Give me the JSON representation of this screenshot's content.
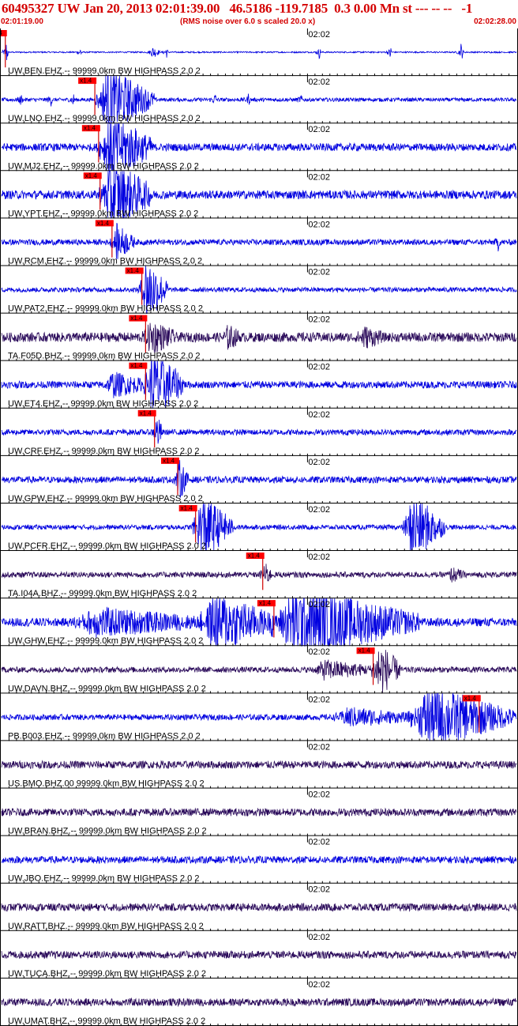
{
  "header": {
    "title": "60495327 UW Jan 20, 2013 02:01:39.00   46.5186 -119.7185  0.3 0.00 Mn st --- -- --   -1",
    "start_time": "02:01:19.00",
    "scale_note": "(RMS noise over 6.0 s scaled 20.0 x)",
    "end_time": "02:02:28.00"
  },
  "colors": {
    "header_text": "#d40000",
    "trace_blue": "#0000e0",
    "trace_purple": "#2a0a5a",
    "pick_box": "#ff0000",
    "pick_line": "#d00000",
    "grid": "#000000"
  },
  "chart_data": {
    "type": "line",
    "x_axis": {
      "start": "02:01:19.00",
      "end": "02:02:28.00",
      "duration_s": 69,
      "minute_mark_label": "02:02",
      "minute_mark_s": 41,
      "tick_interval_s": 1
    },
    "pick_label": "x1.4",
    "series": [
      {
        "name": "UW.BEN.EHZ.--",
        "label": "UW.BEN.EHZ.-- 99999.0km BW  HIGHPASS  2.0  2",
        "color": "blue",
        "pick_s": 0.5,
        "noise": 0.03,
        "bursts": [
          [
            0.6,
            0.3,
            0.6
          ],
          [
            10.5,
            0.3,
            0.3
          ],
          [
            20.0,
            1.2,
            0.25
          ],
          [
            22.0,
            0.3,
            0.3
          ],
          [
            42.5,
            0.3,
            0.3
          ],
          [
            52.0,
            0.3,
            0.35
          ],
          [
            61.5,
            0.4,
            0.4
          ]
        ]
      },
      {
        "name": "UW.LNO.EHZ.--",
        "label": "UW.LNO.EHZ.-- 99999.0km BW  HIGHPASS  2.0  2",
        "color": "blue",
        "pick_s": 12.5,
        "noise": 0.08,
        "bursts": [
          [
            2.5,
            0.3,
            0.25
          ],
          [
            6.5,
            0.3,
            0.3
          ],
          [
            9.5,
            0.3,
            0.3
          ],
          [
            13.0,
            7.5,
            1.4
          ],
          [
            28.5,
            0.3,
            0.35
          ],
          [
            33.0,
            0.3,
            0.25
          ],
          [
            40.0,
            0.3,
            0.2
          ]
        ]
      },
      {
        "name": "UW.MJ2.EHZ.--",
        "label": "UW.MJ2.EHZ.-- 99999.0km BW  HIGHPASS  2.0  2",
        "color": "blue",
        "pick_s": 13.0,
        "noise": 0.16,
        "bursts": [
          [
            13.3,
            7.0,
            1.4
          ]
        ]
      },
      {
        "name": "UW.YPT.EHZ.--",
        "label": "UW.YPT.EHZ.-- 99999.0km BW  HIGHPASS  2.0  2",
        "color": "blue",
        "pick_s": 13.2,
        "noise": 0.18,
        "bursts": [
          [
            13.4,
            7.0,
            1.4
          ]
        ]
      },
      {
        "name": "UW.RCM.EHZ.--",
        "label": "UW.RCM.EHZ.-- 99999.0km BW  HIGHPASS  2.0  2",
        "color": "blue",
        "pick_s": 14.8,
        "noise": 0.12,
        "bursts": [
          [
            15.0,
            2.8,
            0.7
          ],
          [
            66.5,
            0.3,
            0.3
          ]
        ]
      },
      {
        "name": "UW.PAT2.EHZ.--",
        "label": "UW.PAT2.EHZ.-- 99999.0km BW  HIGHPASS  2.0  2",
        "color": "blue",
        "pick_s": 18.8,
        "noise": 0.1,
        "bursts": [
          [
            18.8,
            3.5,
            1.4
          ]
        ]
      },
      {
        "name": "TA.F05D.BHZ.--",
        "label": "TA.F05D.BHZ.-- 99999.0km BW  HIGHPASS  2.0  2",
        "color": "purple",
        "pick_s": 19.3,
        "noise": 0.2,
        "bursts": [
          [
            19.3,
            4.0,
            0.6
          ],
          [
            30.0,
            2.0,
            0.4
          ],
          [
            48.0,
            3.0,
            0.35
          ]
        ]
      },
      {
        "name": "UW.ET4.EHZ.--",
        "label": "UW.ET4.EHZ.-- 99999.0km BW  HIGHPASS  2.0  2",
        "color": "blue",
        "pick_s": 19.3,
        "noise": 0.15,
        "bursts": [
          [
            14.0,
            5.5,
            0.45
          ],
          [
            19.5,
            5.0,
            1.4
          ]
        ]
      },
      {
        "name": "UW.CRF.EHZ.--",
        "label": "UW.CRF.EHZ.-- 99999.0km BW  HIGHPASS  2.0  2",
        "color": "blue",
        "pick_s": 20.5,
        "noise": 0.12,
        "bursts": [
          [
            20.6,
            1.0,
            0.7
          ]
        ]
      },
      {
        "name": "UW.GPW.EHZ.--",
        "label": "UW.GPW.EHZ.-- 99999.0km BW  HIGHPASS  2.0  2",
        "color": "blue",
        "pick_s": 23.6,
        "noise": 0.14,
        "bursts": [
          [
            23.5,
            1.5,
            0.8
          ]
        ]
      },
      {
        "name": "UW.PCFR.EHZ.--",
        "label": "UW.PCFR.EHZ.-- 99999.0km BW  HIGHPASS  2.0  2",
        "color": "blue",
        "pick_s": 26.0,
        "noise": 0.1,
        "bursts": [
          [
            26.0,
            5.0,
            1.4
          ],
          [
            54.2,
            5.2,
            1.4
          ]
        ]
      },
      {
        "name": "TA.I04A.BHZ.--",
        "label": "TA.I04A.BHZ.-- 99999.0km BW  HIGHPASS  2.0  2",
        "color": "purple",
        "pick_s": 35.0,
        "noise": 0.12,
        "bursts": [
          [
            35.0,
            1.2,
            0.45
          ],
          [
            60.0,
            2.0,
            0.25
          ]
        ]
      },
      {
        "name": "UW.GHW.EHZ.--",
        "label": "UW.GHW.EHZ.-- 99999.0km BW  HIGHPASS  2.0  2",
        "color": "blue",
        "pick_s": 36.5,
        "noise": 0.18,
        "bursts": [
          [
            10.0,
            17.0,
            0.5
          ],
          [
            27.0,
            9.5,
            1.2
          ],
          [
            36.5,
            19.5,
            1.4
          ]
        ]
      },
      {
        "name": "UW.DAVN.BHZ.--",
        "label": "UW.DAVN.BHZ.-- 99999.0km BW  HIGHPASS  2.0  2",
        "color": "purple",
        "pick_s": 49.8,
        "noise": 0.12,
        "bursts": [
          [
            42.0,
            8.0,
            0.35
          ],
          [
            50.0,
            3.5,
            1.1
          ]
        ]
      },
      {
        "name": "PB.B003.EHZ.--",
        "label": "PB.B003.EHZ.-- 99999.0km BW  HIGHPASS  2.0  2",
        "color": "blue",
        "pick_s": 64.0,
        "noise": 0.12,
        "bursts": [
          [
            45.0,
            10.0,
            0.35
          ],
          [
            55.0,
            14.0,
            1.25
          ]
        ]
      },
      {
        "name": "US.BMO.BHZ.00",
        "label": "US.BMO.BHZ.00 99999.0km BW  HIGHPASS  2.0  2",
        "color": "purple",
        "noise": 0.16,
        "bursts": []
      },
      {
        "name": "UW.BRAN.BHZ.--",
        "label": "UW.BRAN.BHZ.-- 99999.0km BW  HIGHPASS  2.0  2",
        "color": "purple",
        "noise": 0.16,
        "bursts": []
      },
      {
        "name": "UW.JBO.EHZ.--",
        "label": "UW.JBO.EHZ.-- 99999.0km BW  HIGHPASS  2.0  2",
        "color": "blue",
        "noise": 0.15,
        "bursts": []
      },
      {
        "name": "UW.RATT.BHZ.--",
        "label": "UW.RATT.BHZ.-- 99999.0km BW  HIGHPASS  2.0  2",
        "color": "purple",
        "noise": 0.16,
        "bursts": []
      },
      {
        "name": "UW.TUCA.BHZ.--",
        "label": "UW.TUCA.BHZ.-- 99999.0km BW  HIGHPASS  2.0  2",
        "color": "purple",
        "noise": 0.16,
        "bursts": []
      },
      {
        "name": "UW.UMAT.BHZ.--",
        "label": "UW.UMAT.BHZ.-- 99999.0km BW  HIGHPASS  2.0  2",
        "color": "purple",
        "noise": 0.16,
        "bursts": []
      }
    ]
  }
}
